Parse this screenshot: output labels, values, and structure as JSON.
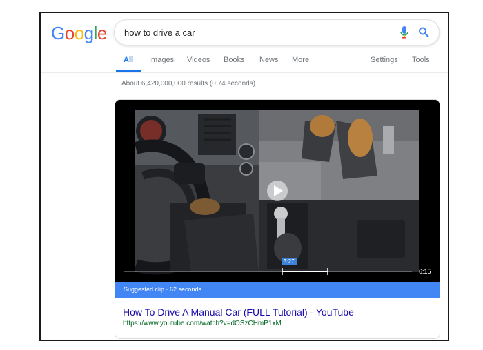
{
  "logo": {
    "letters": [
      "G",
      "o",
      "o",
      "g",
      "l",
      "e"
    ],
    "colors": [
      "#4285f4",
      "#ea4335",
      "#fbbc05",
      "#4285f4",
      "#34a853",
      "#ea4335"
    ]
  },
  "search": {
    "query": "how to drive a car"
  },
  "tabs": {
    "left": [
      "All",
      "Images",
      "Videos",
      "Books",
      "News",
      "More"
    ],
    "right": [
      "Settings",
      "Tools"
    ],
    "active": "All"
  },
  "results_stats": "About 6,420,000,000 results (0.74 seconds)",
  "video": {
    "clip_start": "3:27",
    "duration": "6:15",
    "suggested_clip": "Suggested clip · 62 seconds"
  },
  "result": {
    "title_pre": "How To Drive A Manual Car (",
    "title_bold": "F",
    "title_post": "ULL Tutorial) - YouTube",
    "url": "https://www.youtube.com/watch?v=dOSzCHmP1xM"
  },
  "colors": {
    "accent": "#1a73e8",
    "link": "#1a0dab",
    "url": "#006621",
    "suggested_bar": "#4285f4"
  }
}
